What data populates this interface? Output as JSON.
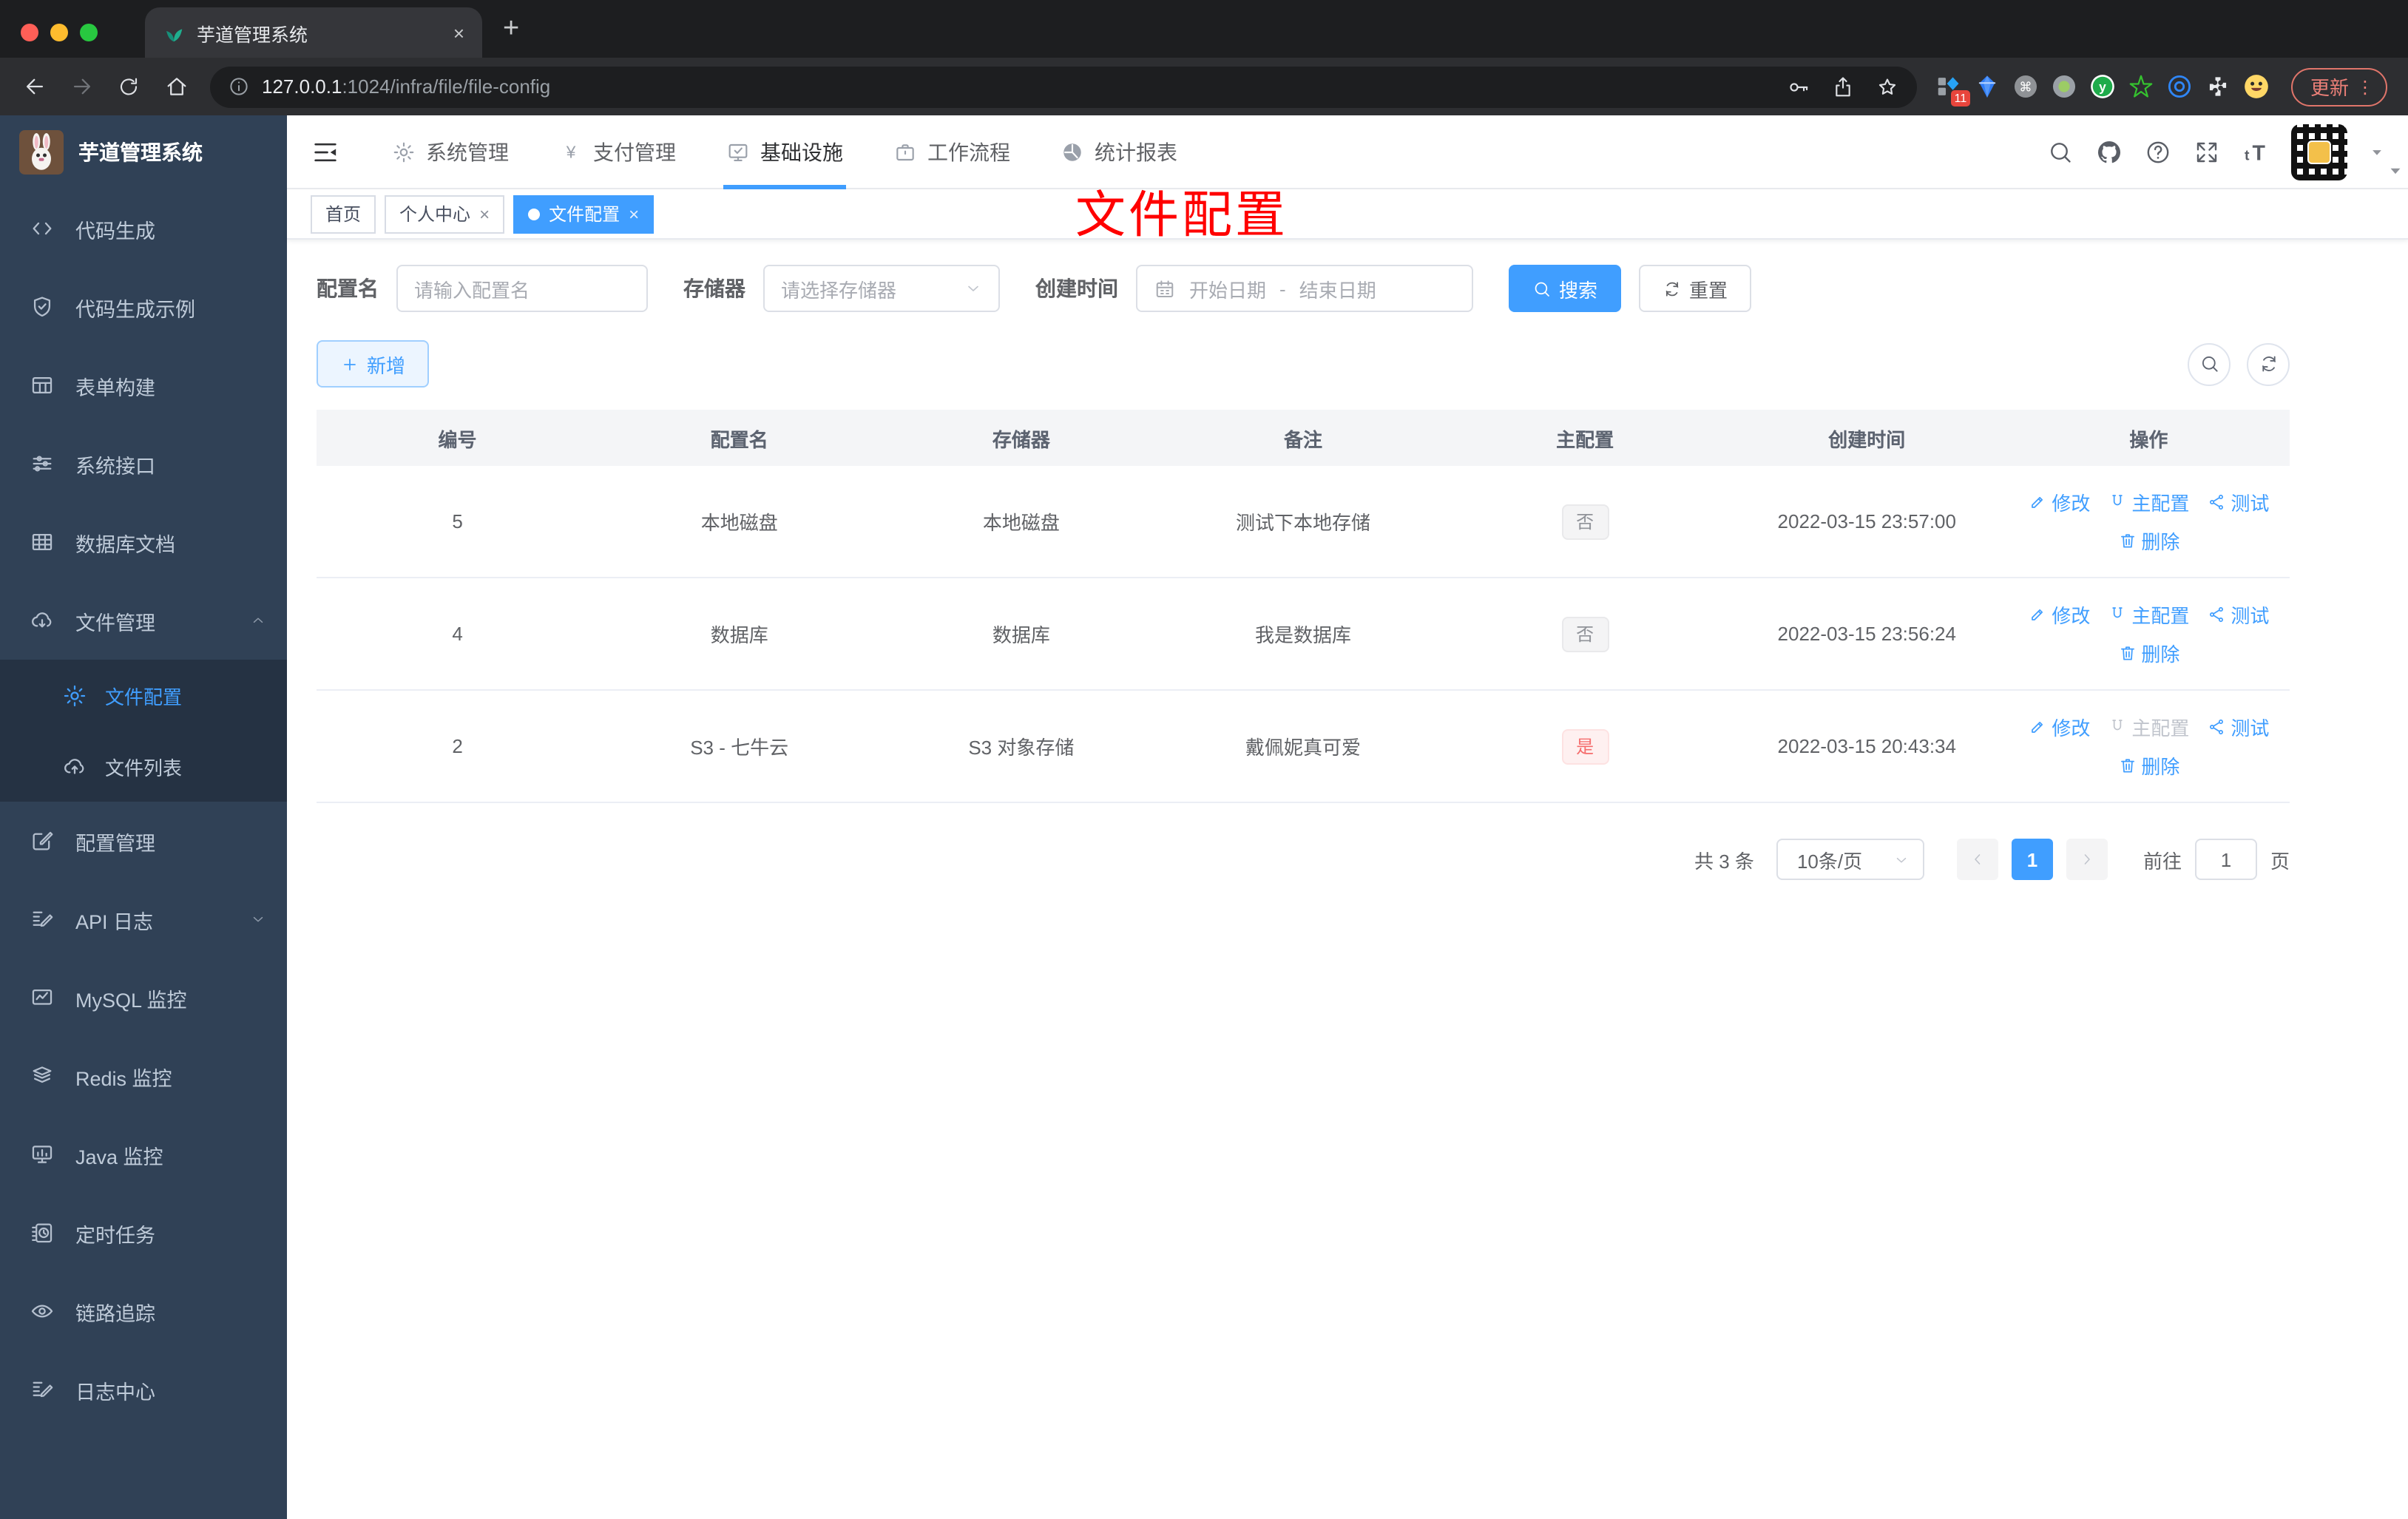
{
  "browser": {
    "tab": {
      "title": "芋道管理系统"
    },
    "address": {
      "host": "127.0.0.1",
      "rest": ":1024/infra/file/file-config"
    },
    "extension_badge": "11",
    "update_label": "更新"
  },
  "colors": {
    "accent": "#409eff",
    "danger": "#f56c6c",
    "annotation": "#ff0000",
    "sidebar_bg": "#304156"
  },
  "sidebar": {
    "title": "芋道管理系统",
    "items": [
      {
        "label": "代码生成",
        "icon": "code-icon"
      },
      {
        "label": "代码生成示例",
        "icon": "shield-check-icon"
      },
      {
        "label": "表单构建",
        "icon": "table-icon"
      },
      {
        "label": "系统接口",
        "icon": "sliders-icon"
      },
      {
        "label": "数据库文档",
        "icon": "grid-icon"
      },
      {
        "label": "文件管理",
        "icon": "cloud-download-icon",
        "expanded": true,
        "children": [
          {
            "label": "文件配置",
            "icon": "gear-icon",
            "active": true
          },
          {
            "label": "文件列表",
            "icon": "cloud-upload-icon"
          }
        ]
      },
      {
        "label": "配置管理",
        "icon": "edit-square-icon"
      },
      {
        "label": "API 日志",
        "icon": "edit-doc-icon",
        "collapsible": true
      },
      {
        "label": "MySQL 监控",
        "icon": "chart-monitor-icon"
      },
      {
        "label": "Redis 监控",
        "icon": "layers-icon"
      },
      {
        "label": "Java 监控",
        "icon": "monitor-icon"
      },
      {
        "label": "定时任务",
        "icon": "schedule-icon"
      },
      {
        "label": "链路追踪",
        "icon": "eye-icon"
      },
      {
        "label": "日志中心",
        "icon": "edit-doc-icon"
      }
    ]
  },
  "topnav": {
    "items": [
      {
        "label": "系统管理",
        "icon": "gear-icon"
      },
      {
        "label": "支付管理",
        "icon": "yen-icon"
      },
      {
        "label": "基础设施",
        "icon": "monitor-check-icon",
        "active": true
      },
      {
        "label": "工作流程",
        "icon": "briefcase-icon"
      },
      {
        "label": "统计报表",
        "icon": "dashboard-icon"
      }
    ]
  },
  "tags": [
    {
      "label": "首页"
    },
    {
      "label": "个人中心",
      "closable": true
    },
    {
      "label": "文件配置",
      "closable": true,
      "active": true
    }
  ],
  "annotation": {
    "text": "文件配置"
  },
  "filter": {
    "name_label": "配置名",
    "name_placeholder": "请输入配置名",
    "storage_label": "存储器",
    "storage_placeholder": "请选择存储器",
    "date_label": "创建时间",
    "date_start_placeholder": "开始日期",
    "date_separator": "-",
    "date_end_placeholder": "结束日期",
    "search_label": "搜索",
    "reset_label": "重置"
  },
  "toolbar": {
    "add_label": "新增"
  },
  "table": {
    "columns": [
      "编号",
      "配置名",
      "存储器",
      "备注",
      "主配置",
      "创建时间",
      "操作"
    ],
    "actions": {
      "edit": "修改",
      "master": "主配置",
      "test": "测试",
      "delete": "删除"
    },
    "rows": [
      {
        "id": "5",
        "name": "本地磁盘",
        "storage": "本地磁盘",
        "remark": "测试下本地存储",
        "master": "否",
        "master_type": "info",
        "created": "2022-03-15 23:57:00",
        "master_disabled": false
      },
      {
        "id": "4",
        "name": "数据库",
        "storage": "数据库",
        "remark": "我是数据库",
        "master": "否",
        "master_type": "info",
        "created": "2022-03-15 23:56:24",
        "master_disabled": false
      },
      {
        "id": "2",
        "name": "S3 - 七牛云",
        "storage": "S3 对象存储",
        "remark": "戴佩妮真可爱",
        "master": "是",
        "master_type": "danger",
        "created": "2022-03-15 20:43:34",
        "master_disabled": true
      }
    ]
  },
  "pagination": {
    "total": "共 3 条",
    "page_size": "10条/页",
    "current_page": "1",
    "goto_label": "前往",
    "goto_value": "1",
    "page_unit": "页"
  }
}
